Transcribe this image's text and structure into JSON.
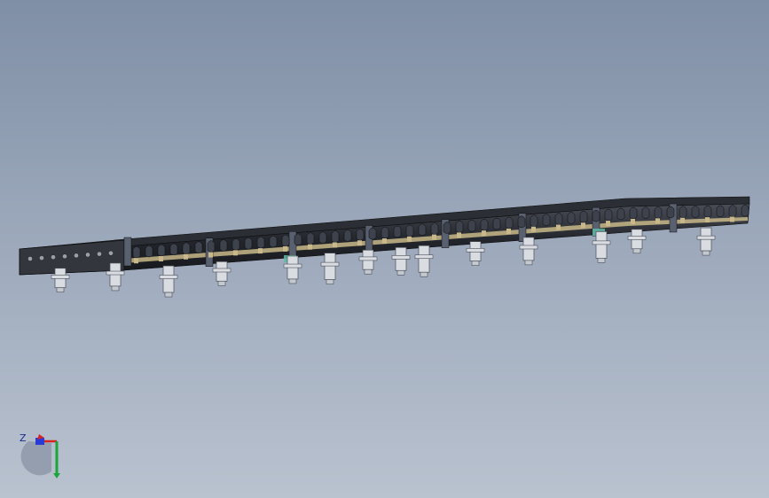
{
  "viewport": {
    "background_top": "#7f8fa6",
    "background_bottom": "#b9c2cf"
  },
  "model": {
    "body_color": "#1e2127",
    "frame_color": "#3a3f48",
    "accent_color": "#c8b88a",
    "highlight_color": "#5fb8a4",
    "leg_color": "#d9dde2",
    "leg_outline": "#4a4f58"
  },
  "triad": {
    "axis_z_label": "Z",
    "x_color": "#d62424",
    "y_color": "#1aa63a",
    "z_color": "#2a3ad6"
  }
}
